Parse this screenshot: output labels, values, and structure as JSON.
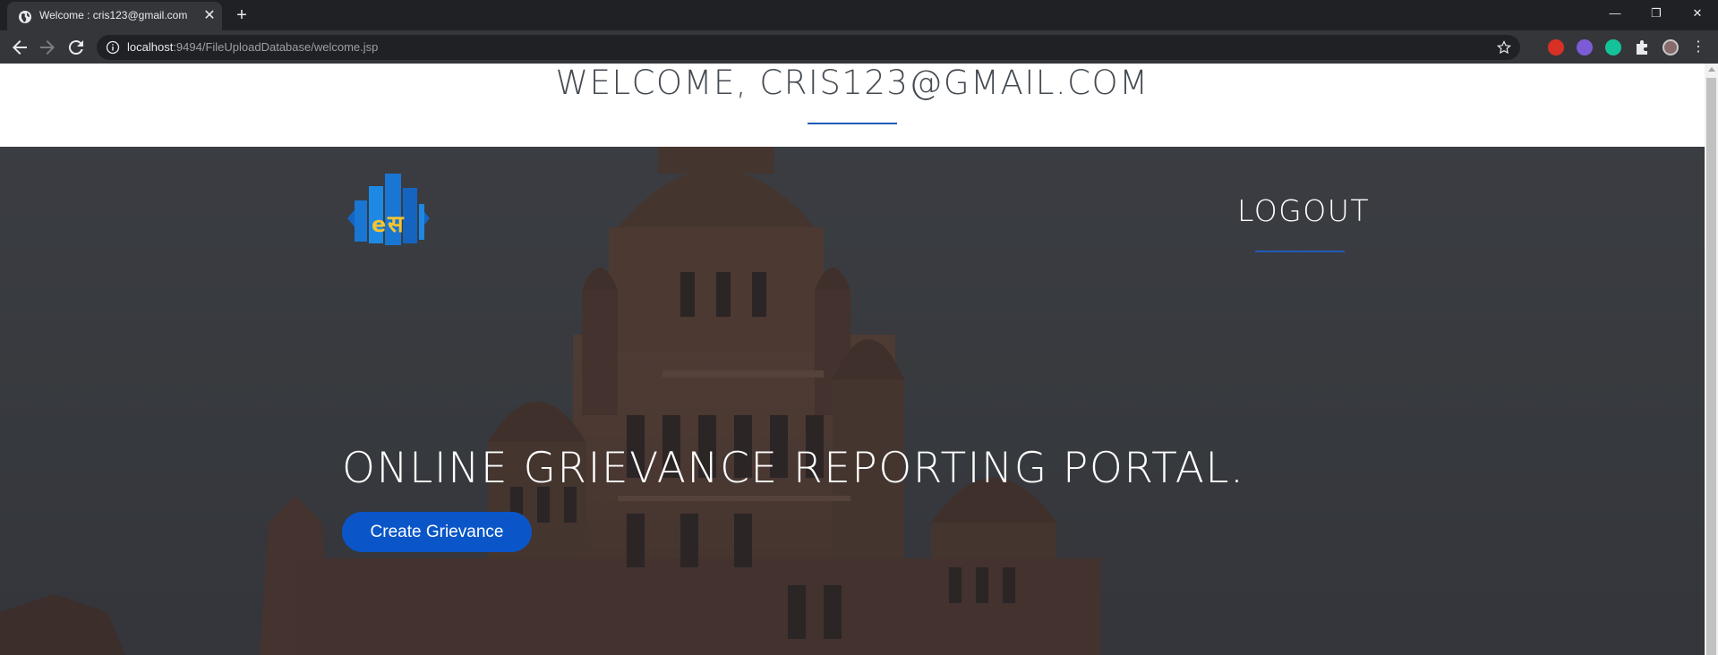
{
  "browser": {
    "tab_title": "Welcome : cris123@gmail.com",
    "url_host": "localhost",
    "url_rest": ":9494/FileUploadDatabase/welcome.jsp",
    "new_tab_label": "+",
    "close_tab_label": "✕"
  },
  "header": {
    "welcome_text": "WELCOME, CRIS123@GMAIL.COM",
    "accent_color": "#1e5bb8"
  },
  "hero": {
    "logout_label": "LOGOUT",
    "title": "ONLINE GRIEVANCE REPORTING PORTAL.",
    "cta_label": "Create Grievance",
    "cta_color": "#0a56c8",
    "background_image": "municipal-building-photo"
  }
}
